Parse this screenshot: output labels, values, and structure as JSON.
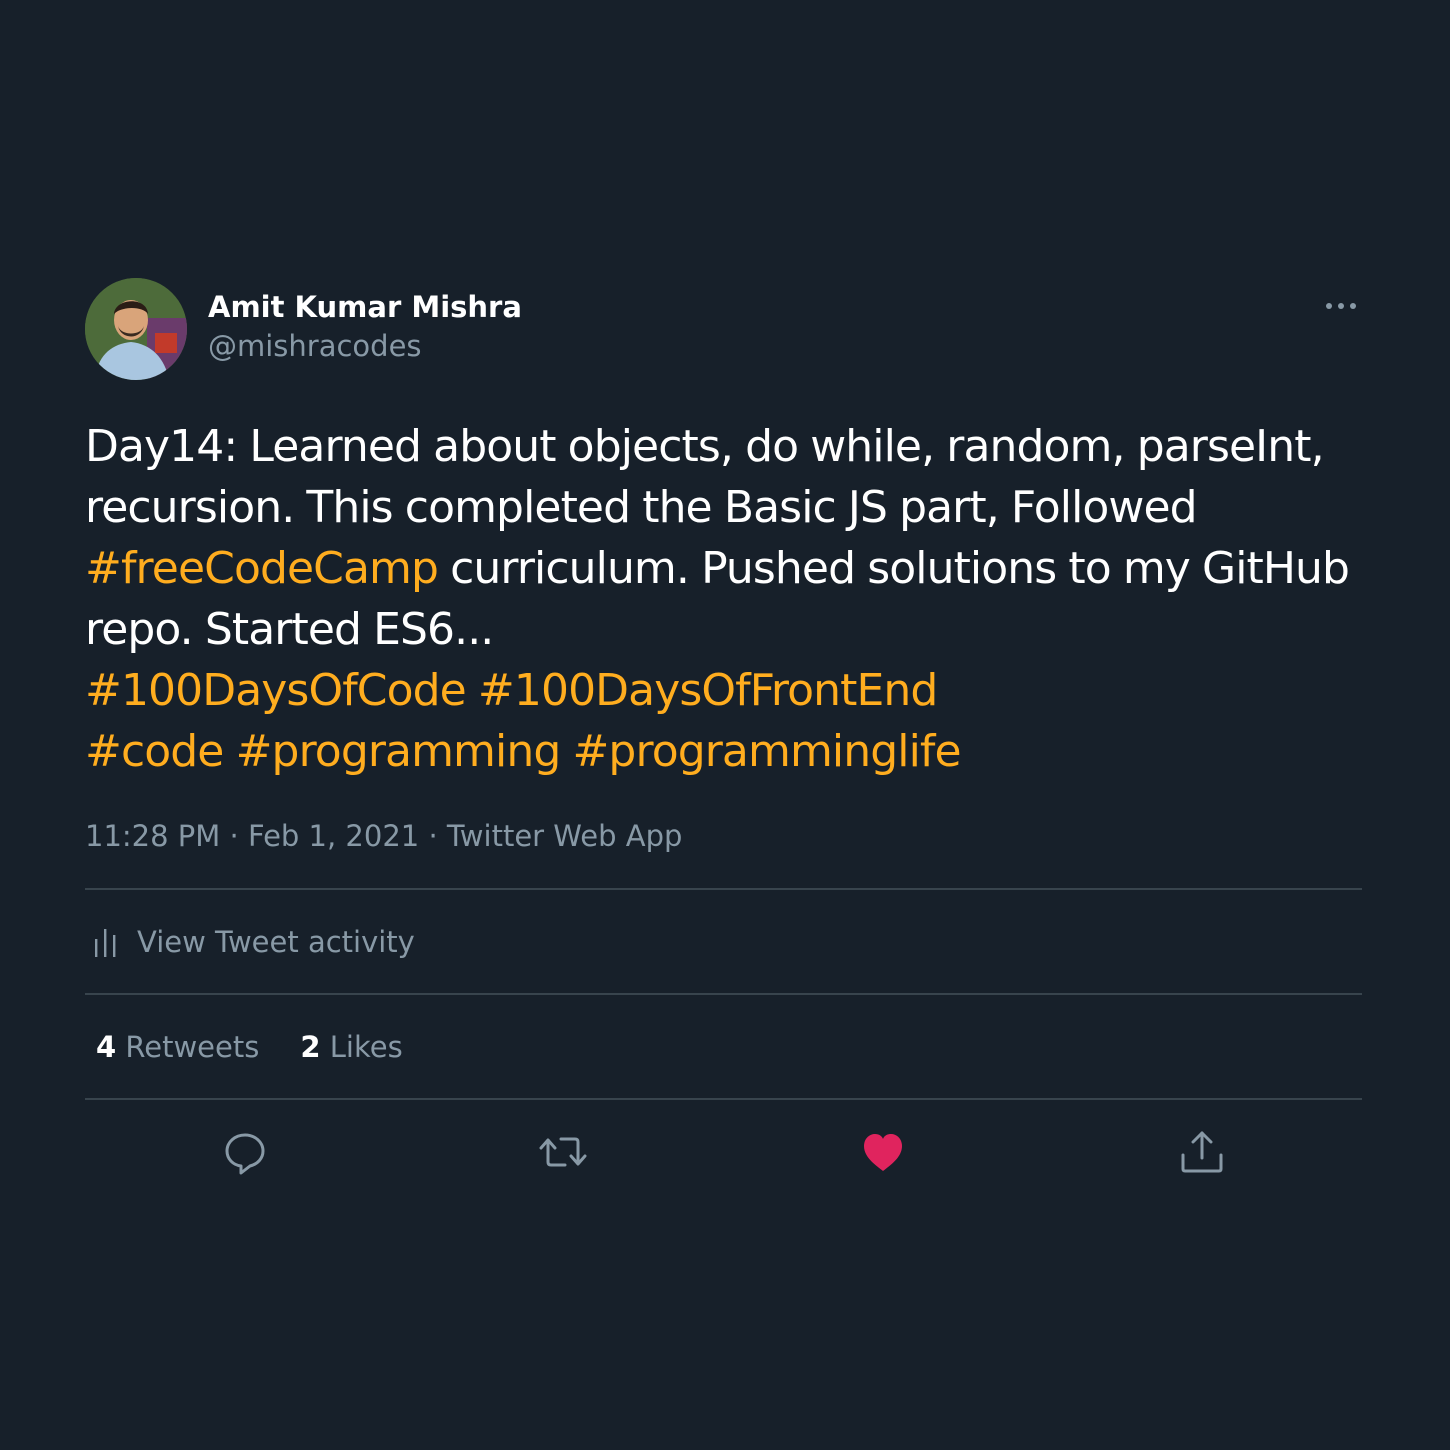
{
  "user": {
    "display_name": "Amit Kumar Mishra",
    "handle": "@mishracodes"
  },
  "tweet": {
    "line1": "Day14: Learned about objects, do while, random, parseInt,",
    "line2": "recursion. This completed the Basic JS part, Followed",
    "line3_tag": "#freeCodeCamp",
    "line3_rest": " curriculum. Pushed solutions to my GitHub",
    "line4": "repo. Started ES6...",
    "hashtags_line5": [
      "#100DaysOfCode",
      "#100DaysOfFrontEnd"
    ],
    "hashtags_line6": [
      "#code",
      "#programming",
      "#programminglife"
    ]
  },
  "meta": {
    "time": "11:28 PM",
    "date": "Feb 1, 2021",
    "separator": "·",
    "source": "Twitter Web App"
  },
  "activity": {
    "label": "View Tweet activity",
    "icon": "bar-chart-icon"
  },
  "stats": {
    "retweets_count": "4",
    "retweets_label": "Retweets",
    "likes_count": "2",
    "likes_label": "Likes"
  },
  "actions": [
    "reply-icon",
    "retweet-icon",
    "like-icon",
    "share-icon"
  ],
  "colors": {
    "background": "#17202a",
    "hashtag": "#ffad1f",
    "secondary_text": "#8899a6",
    "divider": "#38444d",
    "like": "#e0245e"
  }
}
